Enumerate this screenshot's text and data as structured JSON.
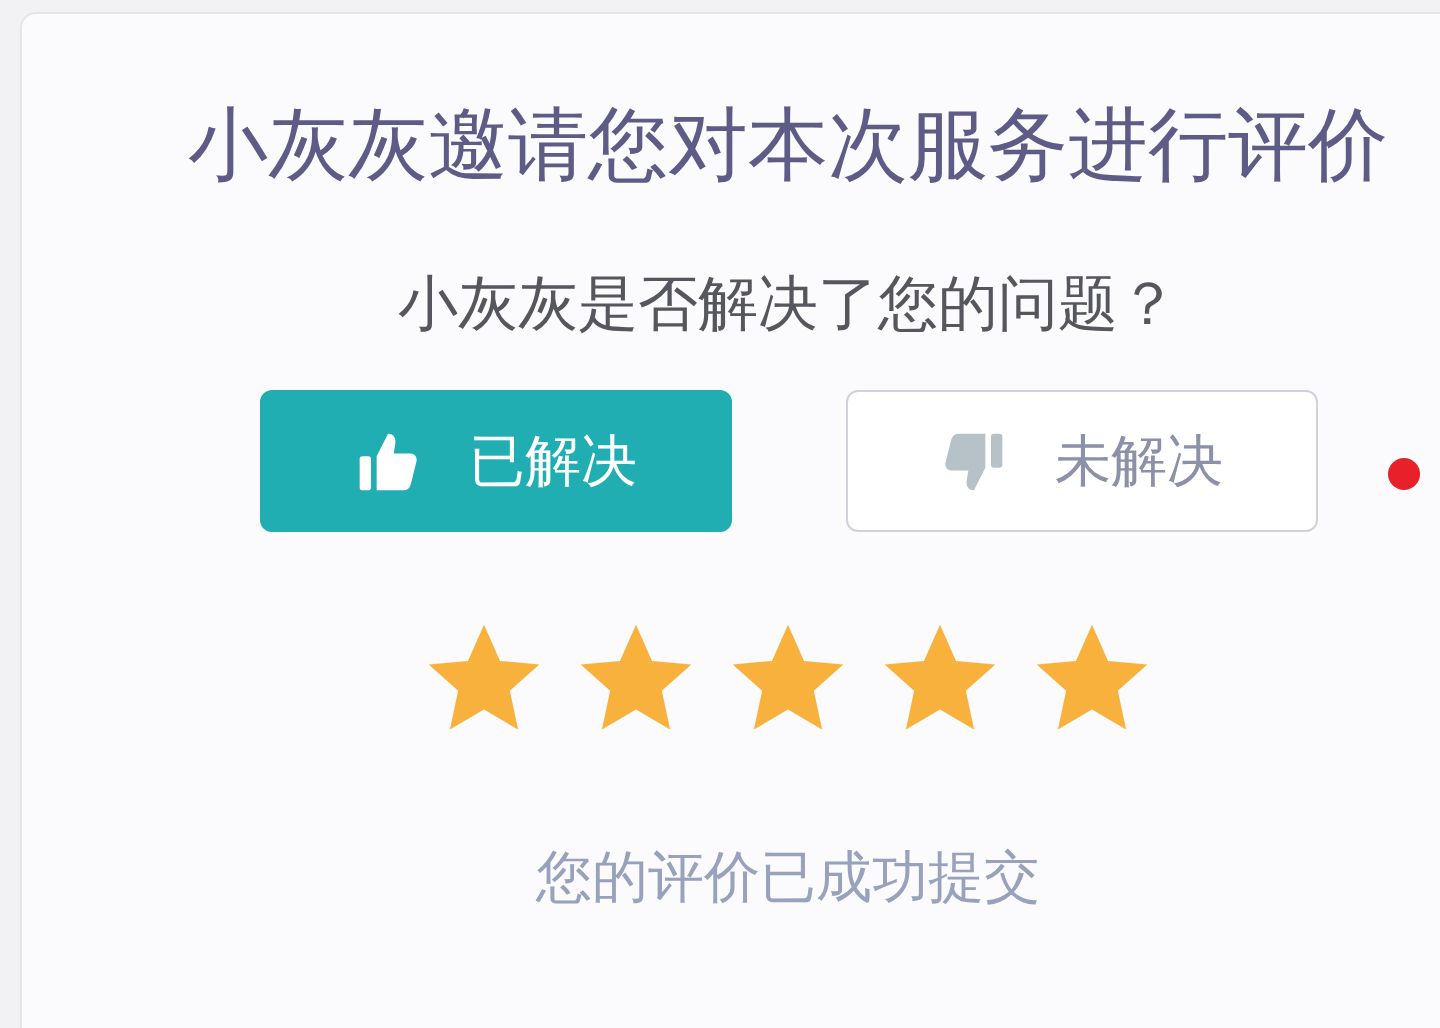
{
  "title": "小灰灰邀请您对本次服务进行评价",
  "question": "小灰灰是否解决了您的问题？",
  "options": [
    {
      "label": "已解决",
      "kind": "up",
      "selected": true
    },
    {
      "label": "未解决",
      "kind": "down",
      "selected": false
    }
  ],
  "notification_dot": {
    "color": "#e8202a"
  },
  "rating": {
    "stars": 5
  },
  "confirmation": "您的评价已成功提交"
}
